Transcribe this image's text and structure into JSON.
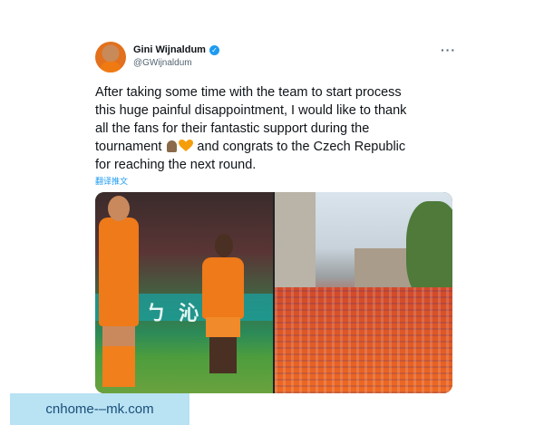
{
  "author": {
    "display_name": "Gini Wijnaldum",
    "handle": "@GWijnaldum",
    "verified": true
  },
  "tweet": {
    "line1": "After taking some time with the team to start process",
    "line2": "this huge painful disappointment, I would like to thank",
    "line3": "all the fans for their fantastic support during the",
    "line4_pre": "tournament",
    "line4_post": "and congrats to the Czech Republic",
    "line5": "for reaching the next round.",
    "translate_link": "翻译推文"
  },
  "media": {
    "left_photo_banner_text": "吉 ㄅ 沁"
  },
  "icons": {
    "more": "more-horizontal-icon",
    "verified": "verified-badge-icon",
    "pray": "folded-hands-emoji",
    "heart": "orange-heart-emoji"
  },
  "colors": {
    "link": "#1d9bf0",
    "secondary_text": "#536471",
    "heart": "#f59e0b"
  },
  "watermark": {
    "text": "cnhome-–mk.com"
  }
}
